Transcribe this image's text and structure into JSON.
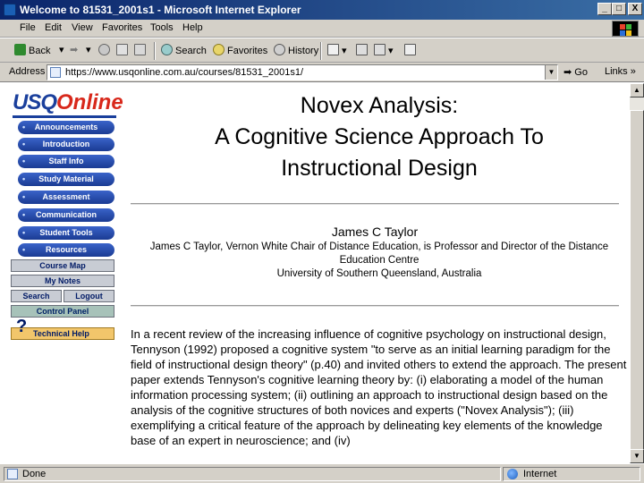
{
  "window": {
    "title": "Welcome to 81531_2001s1 - Microsoft Internet Explorer",
    "controls": {
      "minimize": "_",
      "maximize": "□",
      "close": "X"
    }
  },
  "menu": [
    "File",
    "Edit",
    "View",
    "Favorites",
    "Tools",
    "Help"
  ],
  "toolbar": {
    "back": "Back",
    "forward_icon": "forward-arrow-icon",
    "search": "Search",
    "favorites": "Favorites",
    "history": "History"
  },
  "address": {
    "label": "Address",
    "url": "https://www.usqonline.com.au/courses/81531_2001s1/",
    "go": "Go",
    "links": "Links"
  },
  "sidebar": {
    "logo_usq": "USQ",
    "logo_online": "Online",
    "nav": [
      "Announcements",
      "Introduction",
      "Staff Info",
      "Study Material",
      "Assessment",
      "Communication",
      "Student Tools",
      "Resources"
    ],
    "course_map": "Course Map",
    "my_notes": "My Notes",
    "search": "Search",
    "logout": "Logout",
    "control_panel": "Control Panel",
    "tech_help_mark": "?",
    "tech_help": "Technical Help"
  },
  "article": {
    "title_line1": "Novex Analysis:",
    "title_line2": "A Cognitive Science Approach To",
    "title_line3": "Instructional Design",
    "author": "James C Taylor",
    "affiliation_line1": "James C Taylor, Vernon White Chair of Distance Education, is Professor and Director of the Distance",
    "affiliation_line2": "Education Centre",
    "affiliation_line3": "University of Southern Queensland, Australia",
    "abstract": "In a recent review of the increasing influence of cognitive psychology on instructional design, Tennyson (1992) proposed a cognitive system \"to serve as an initial learning paradigm for the field of instructional design theory\" (p.40) and invited others to extend the approach. The present paper extends Tennyson's cognitive learning theory by: (i) elaborating a model of the human information processing system; (ii) outlining an approach to instructional design based on the analysis of the cognitive structures of both novices and experts (\"Novex Analysis\"); (iii) exemplifying a critical feature of the approach by delineating key elements of the knowledge base of an expert in neuroscience; and (iv)"
  },
  "status": {
    "left": "Done",
    "zone": "Internet"
  }
}
